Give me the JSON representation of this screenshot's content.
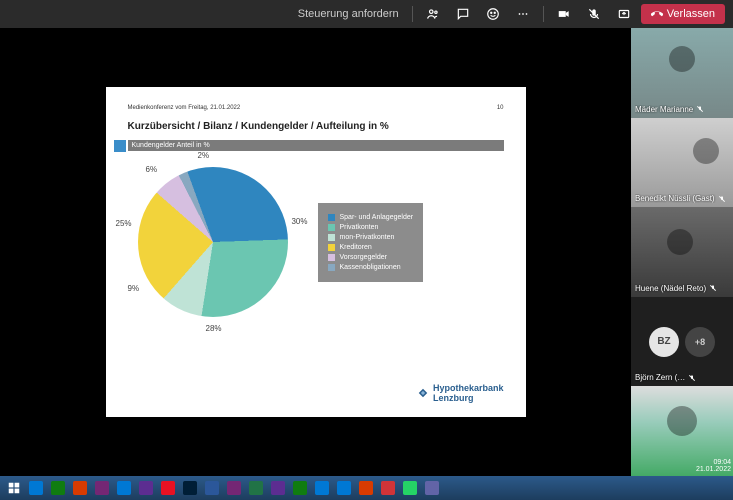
{
  "topbar": {
    "request_control": "Steuerung anfordern",
    "leave": "Verlassen"
  },
  "slide": {
    "meta_left": "Medienkonferenz vom Freitag, 21.01.2022",
    "meta_right": "10",
    "title": "Kurzübersicht / Bilanz / Kundengelder / Aufteilung in %",
    "subtitle": "Kundengelder Anteil in %",
    "brand_line1": "Hypothekarbank",
    "brand_line2": "Lenzburg"
  },
  "chart_data": {
    "type": "pie",
    "title": "Kundengelder Anteil in %",
    "series": [
      {
        "name": "Spar- und Anlagegelder",
        "value": 30,
        "color": "#2f86bf"
      },
      {
        "name": "Privatkonten",
        "value": 28,
        "color": "#6bc6b1"
      },
      {
        "name": "mon-Privatkonten",
        "value": 9,
        "color": "#bfe3d6"
      },
      {
        "name": "Kreditoren",
        "value": 25,
        "color": "#f2d33b"
      },
      {
        "name": "Vorsorgegelder",
        "value": 6,
        "color": "#d6bfe0"
      },
      {
        "name": "Kassenobligationen",
        "value": 2,
        "color": "#88a8c0"
      }
    ]
  },
  "participants": [
    {
      "name": "Mäder Marianne"
    },
    {
      "name": "Benedikt Nüssli (Gast)"
    },
    {
      "name": "Huene (Nädel Reto)"
    },
    {
      "initials": "BZ",
      "extra": "+8",
      "name": "Björn Zern (…"
    },
    {
      "name": ""
    }
  ],
  "clock": {
    "time": "09:04",
    "date": "21.01.2022"
  },
  "taskbar_colors": [
    "#0078d4",
    "#107c10",
    "#d83b01",
    "#742774",
    "#0078d4",
    "#5c2d91",
    "#e81123",
    "#001E36",
    "#2b579a",
    "#742774",
    "#217346",
    "#5c2d91",
    "#107c10",
    "#0078d4",
    "#0078d4",
    "#d83b01",
    "#d13438",
    "#25d366",
    "#6264a7"
  ]
}
